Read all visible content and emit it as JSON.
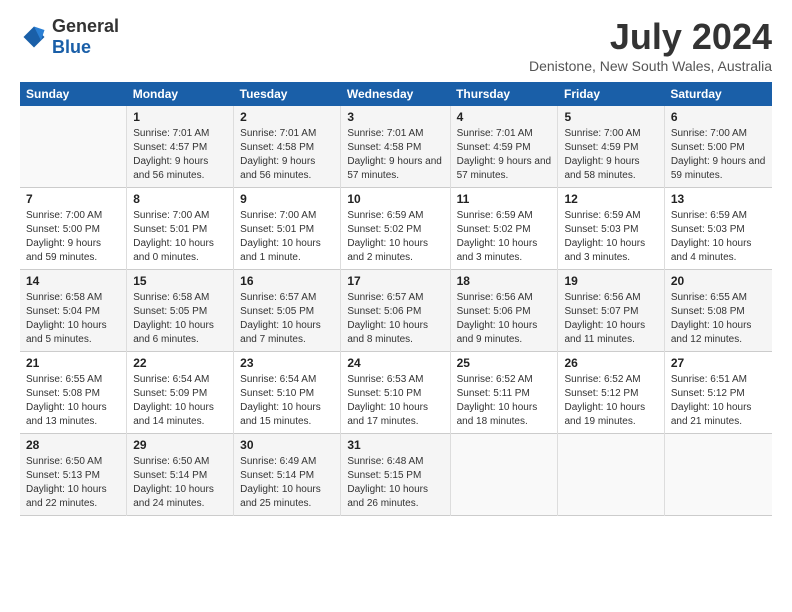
{
  "logo": {
    "text_general": "General",
    "text_blue": "Blue"
  },
  "title": "July 2024",
  "subtitle": "Denistone, New South Wales, Australia",
  "calendar": {
    "headers": [
      "Sunday",
      "Monday",
      "Tuesday",
      "Wednesday",
      "Thursday",
      "Friday",
      "Saturday"
    ],
    "rows": [
      [
        {
          "day": "",
          "empty": true
        },
        {
          "day": "1",
          "sunrise": "7:01 AM",
          "sunset": "4:57 PM",
          "daylight": "9 hours and 56 minutes."
        },
        {
          "day": "2",
          "sunrise": "7:01 AM",
          "sunset": "4:58 PM",
          "daylight": "9 hours and 56 minutes."
        },
        {
          "day": "3",
          "sunrise": "7:01 AM",
          "sunset": "4:58 PM",
          "daylight": "9 hours and 57 minutes."
        },
        {
          "day": "4",
          "sunrise": "7:01 AM",
          "sunset": "4:59 PM",
          "daylight": "9 hours and 57 minutes."
        },
        {
          "day": "5",
          "sunrise": "7:00 AM",
          "sunset": "4:59 PM",
          "daylight": "9 hours and 58 minutes."
        },
        {
          "day": "6",
          "sunrise": "7:00 AM",
          "sunset": "5:00 PM",
          "daylight": "9 hours and 59 minutes."
        }
      ],
      [
        {
          "day": "7",
          "sunrise": "7:00 AM",
          "sunset": "5:00 PM",
          "daylight": "9 hours and 59 minutes."
        },
        {
          "day": "8",
          "sunrise": "7:00 AM",
          "sunset": "5:01 PM",
          "daylight": "10 hours and 0 minutes."
        },
        {
          "day": "9",
          "sunrise": "7:00 AM",
          "sunset": "5:01 PM",
          "daylight": "10 hours and 1 minute."
        },
        {
          "day": "10",
          "sunrise": "6:59 AM",
          "sunset": "5:02 PM",
          "daylight": "10 hours and 2 minutes."
        },
        {
          "day": "11",
          "sunrise": "6:59 AM",
          "sunset": "5:02 PM",
          "daylight": "10 hours and 3 minutes."
        },
        {
          "day": "12",
          "sunrise": "6:59 AM",
          "sunset": "5:03 PM",
          "daylight": "10 hours and 3 minutes."
        },
        {
          "day": "13",
          "sunrise": "6:59 AM",
          "sunset": "5:03 PM",
          "daylight": "10 hours and 4 minutes."
        }
      ],
      [
        {
          "day": "14",
          "sunrise": "6:58 AM",
          "sunset": "5:04 PM",
          "daylight": "10 hours and 5 minutes."
        },
        {
          "day": "15",
          "sunrise": "6:58 AM",
          "sunset": "5:05 PM",
          "daylight": "10 hours and 6 minutes."
        },
        {
          "day": "16",
          "sunrise": "6:57 AM",
          "sunset": "5:05 PM",
          "daylight": "10 hours and 7 minutes."
        },
        {
          "day": "17",
          "sunrise": "6:57 AM",
          "sunset": "5:06 PM",
          "daylight": "10 hours and 8 minutes."
        },
        {
          "day": "18",
          "sunrise": "6:56 AM",
          "sunset": "5:06 PM",
          "daylight": "10 hours and 9 minutes."
        },
        {
          "day": "19",
          "sunrise": "6:56 AM",
          "sunset": "5:07 PM",
          "daylight": "10 hours and 11 minutes."
        },
        {
          "day": "20",
          "sunrise": "6:55 AM",
          "sunset": "5:08 PM",
          "daylight": "10 hours and 12 minutes."
        }
      ],
      [
        {
          "day": "21",
          "sunrise": "6:55 AM",
          "sunset": "5:08 PM",
          "daylight": "10 hours and 13 minutes."
        },
        {
          "day": "22",
          "sunrise": "6:54 AM",
          "sunset": "5:09 PM",
          "daylight": "10 hours and 14 minutes."
        },
        {
          "day": "23",
          "sunrise": "6:54 AM",
          "sunset": "5:10 PM",
          "daylight": "10 hours and 15 minutes."
        },
        {
          "day": "24",
          "sunrise": "6:53 AM",
          "sunset": "5:10 PM",
          "daylight": "10 hours and 17 minutes."
        },
        {
          "day": "25",
          "sunrise": "6:52 AM",
          "sunset": "5:11 PM",
          "daylight": "10 hours and 18 minutes."
        },
        {
          "day": "26",
          "sunrise": "6:52 AM",
          "sunset": "5:12 PM",
          "daylight": "10 hours and 19 minutes."
        },
        {
          "day": "27",
          "sunrise": "6:51 AM",
          "sunset": "5:12 PM",
          "daylight": "10 hours and 21 minutes."
        }
      ],
      [
        {
          "day": "28",
          "sunrise": "6:50 AM",
          "sunset": "5:13 PM",
          "daylight": "10 hours and 22 minutes."
        },
        {
          "day": "29",
          "sunrise": "6:50 AM",
          "sunset": "5:14 PM",
          "daylight": "10 hours and 24 minutes."
        },
        {
          "day": "30",
          "sunrise": "6:49 AM",
          "sunset": "5:14 PM",
          "daylight": "10 hours and 25 minutes."
        },
        {
          "day": "31",
          "sunrise": "6:48 AM",
          "sunset": "5:15 PM",
          "daylight": "10 hours and 26 minutes."
        },
        {
          "day": "",
          "empty": true
        },
        {
          "day": "",
          "empty": true
        },
        {
          "day": "",
          "empty": true
        }
      ]
    ]
  }
}
